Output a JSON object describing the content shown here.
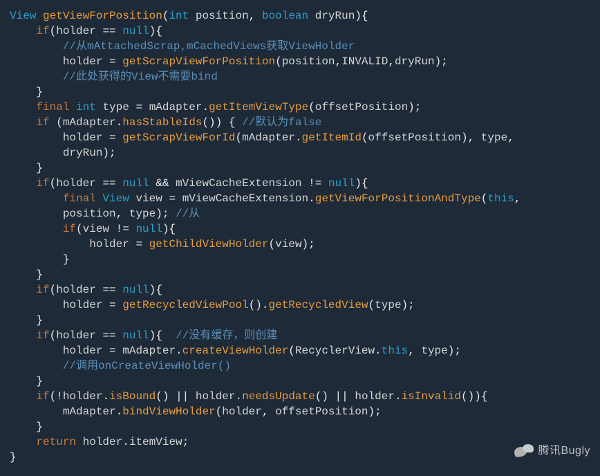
{
  "code": {
    "lines": [
      [
        [
          "t-type",
          "View"
        ],
        [
          "t-default",
          " "
        ],
        [
          "t-method",
          "getViewForPosition"
        ],
        [
          "t-default",
          "("
        ],
        [
          "t-type",
          "int"
        ],
        [
          "t-default",
          " "
        ],
        [
          "t-param",
          "position"
        ],
        [
          "t-default",
          ", "
        ],
        [
          "t-type",
          "boolean"
        ],
        [
          "t-default",
          " "
        ],
        [
          "t-param",
          "dryRun"
        ],
        [
          "t-default",
          ")"
        ],
        [
          "t-default",
          "{"
        ]
      ],
      [
        [
          "t-default",
          "    "
        ],
        [
          "t-keyword",
          "if"
        ],
        [
          "t-default",
          "("
        ],
        [
          "t-param",
          "holder"
        ],
        [
          "t-default",
          " "
        ],
        [
          "t-op",
          "=="
        ],
        [
          "t-default",
          " "
        ],
        [
          "t-type",
          "null"
        ],
        [
          "t-default",
          ")"
        ],
        [
          "t-default",
          "{"
        ]
      ],
      [
        [
          "t-default",
          "        "
        ],
        [
          "t-comment",
          "//从mAttachedScrap,mCachedViews获取ViewHolder"
        ]
      ],
      [
        [
          "t-default",
          "        "
        ],
        [
          "t-param",
          "holder"
        ],
        [
          "t-default",
          " "
        ],
        [
          "t-op",
          "="
        ],
        [
          "t-default",
          " "
        ],
        [
          "t-method",
          "getScrapViewForPosition"
        ],
        [
          "t-default",
          "("
        ],
        [
          "t-param",
          "position"
        ],
        [
          "t-default",
          ","
        ],
        [
          "t-param",
          "INVALID"
        ],
        [
          "t-default",
          ","
        ],
        [
          "t-param",
          "dryRun"
        ],
        [
          "t-default",
          ")"
        ],
        [
          "t-default",
          ";"
        ]
      ],
      [
        [
          "t-default",
          "        "
        ],
        [
          "t-comment",
          "//此处获得的View不需要bind"
        ]
      ],
      [
        [
          "t-default",
          "    "
        ],
        [
          "t-default",
          "}"
        ]
      ],
      [
        [
          "t-default",
          "    "
        ],
        [
          "t-keyword",
          "final"
        ],
        [
          "t-default",
          " "
        ],
        [
          "t-type",
          "int"
        ],
        [
          "t-default",
          " "
        ],
        [
          "t-param",
          "type"
        ],
        [
          "t-default",
          " "
        ],
        [
          "t-op",
          "="
        ],
        [
          "t-default",
          " "
        ],
        [
          "t-param",
          "mAdapter"
        ],
        [
          "t-default",
          "."
        ],
        [
          "t-method",
          "getItemViewType"
        ],
        [
          "t-default",
          "("
        ],
        [
          "t-param",
          "offsetPosition"
        ],
        [
          "t-default",
          ")"
        ],
        [
          "t-default",
          ";"
        ]
      ],
      [
        [
          "t-default",
          "    "
        ],
        [
          "t-keyword",
          "if"
        ],
        [
          "t-default",
          " ("
        ],
        [
          "t-param",
          "mAdapter"
        ],
        [
          "t-default",
          "."
        ],
        [
          "t-method",
          "hasStableIds"
        ],
        [
          "t-default",
          "()"
        ],
        [
          "t-default",
          ") "
        ],
        [
          "t-default",
          "{ "
        ],
        [
          "t-comment",
          "//默认为false"
        ]
      ],
      [
        [
          "t-default",
          "        "
        ],
        [
          "t-param",
          "holder"
        ],
        [
          "t-default",
          " "
        ],
        [
          "t-op",
          "="
        ],
        [
          "t-default",
          " "
        ],
        [
          "t-method",
          "getScrapViewForId"
        ],
        [
          "t-default",
          "("
        ],
        [
          "t-param",
          "mAdapter"
        ],
        [
          "t-default",
          "."
        ],
        [
          "t-method",
          "getItemId"
        ],
        [
          "t-default",
          "("
        ],
        [
          "t-param",
          "offsetPosition"
        ],
        [
          "t-default",
          ")"
        ],
        [
          "t-default",
          ", "
        ],
        [
          "t-param",
          "type"
        ],
        [
          "t-default",
          ", "
        ]
      ],
      [
        [
          "t-default",
          "        "
        ],
        [
          "t-param",
          "dryRun"
        ],
        [
          "t-default",
          ")"
        ],
        [
          "t-default",
          ";"
        ]
      ],
      [
        [
          "t-default",
          "    "
        ],
        [
          "t-default",
          "}"
        ]
      ],
      [
        [
          "t-default",
          "    "
        ],
        [
          "t-keyword",
          "if"
        ],
        [
          "t-default",
          "("
        ],
        [
          "t-param",
          "holder"
        ],
        [
          "t-default",
          " "
        ],
        [
          "t-op",
          "=="
        ],
        [
          "t-default",
          " "
        ],
        [
          "t-type",
          "null"
        ],
        [
          "t-default",
          " "
        ],
        [
          "t-op",
          "&&"
        ],
        [
          "t-default",
          " "
        ],
        [
          "t-param",
          "mViewCacheExtension"
        ],
        [
          "t-default",
          " "
        ],
        [
          "t-op",
          "!="
        ],
        [
          "t-default",
          " "
        ],
        [
          "t-type",
          "null"
        ],
        [
          "t-default",
          ")"
        ],
        [
          "t-default",
          "{"
        ]
      ],
      [
        [
          "t-default",
          "        "
        ],
        [
          "t-keyword",
          "final"
        ],
        [
          "t-default",
          " "
        ],
        [
          "t-type",
          "View"
        ],
        [
          "t-default",
          " "
        ],
        [
          "t-param",
          "view"
        ],
        [
          "t-default",
          " "
        ],
        [
          "t-op",
          "="
        ],
        [
          "t-default",
          " "
        ],
        [
          "t-param",
          "mViewCacheExtension"
        ],
        [
          "t-default",
          "."
        ],
        [
          "t-method",
          "getViewForPositionAndType"
        ],
        [
          "t-default",
          "("
        ],
        [
          "t-type",
          "this"
        ],
        [
          "t-default",
          ", "
        ]
      ],
      [
        [
          "t-default",
          "        "
        ],
        [
          "t-param",
          "position"
        ],
        [
          "t-default",
          ", "
        ],
        [
          "t-param",
          "type"
        ],
        [
          "t-default",
          ")"
        ],
        [
          "t-default",
          "; "
        ],
        [
          "t-comment",
          "//从"
        ]
      ],
      [
        [
          "t-default",
          "        "
        ],
        [
          "t-keyword",
          "if"
        ],
        [
          "t-default",
          "("
        ],
        [
          "t-param",
          "view"
        ],
        [
          "t-default",
          " "
        ],
        [
          "t-op",
          "!="
        ],
        [
          "t-default",
          " "
        ],
        [
          "t-type",
          "null"
        ],
        [
          "t-default",
          ")"
        ],
        [
          "t-default",
          "{"
        ]
      ],
      [
        [
          "t-default",
          "            "
        ],
        [
          "t-param",
          "holder"
        ],
        [
          "t-default",
          " "
        ],
        [
          "t-op",
          "="
        ],
        [
          "t-default",
          " "
        ],
        [
          "t-method",
          "getChildViewHolder"
        ],
        [
          "t-default",
          "("
        ],
        [
          "t-param",
          "view"
        ],
        [
          "t-default",
          ")"
        ],
        [
          "t-default",
          ";"
        ]
      ],
      [
        [
          "t-default",
          "        "
        ],
        [
          "t-default",
          "}"
        ]
      ],
      [
        [
          "t-default",
          "    "
        ],
        [
          "t-default",
          "}"
        ]
      ],
      [
        [
          "t-default",
          "    "
        ],
        [
          "t-keyword",
          "if"
        ],
        [
          "t-default",
          "("
        ],
        [
          "t-param",
          "holder"
        ],
        [
          "t-default",
          " "
        ],
        [
          "t-op",
          "=="
        ],
        [
          "t-default",
          " "
        ],
        [
          "t-type",
          "null"
        ],
        [
          "t-default",
          ")"
        ],
        [
          "t-default",
          "{"
        ]
      ],
      [
        [
          "t-default",
          "        "
        ],
        [
          "t-param",
          "holder"
        ],
        [
          "t-default",
          " "
        ],
        [
          "t-op",
          "="
        ],
        [
          "t-default",
          " "
        ],
        [
          "t-method",
          "getRecycledViewPool"
        ],
        [
          "t-default",
          "()"
        ],
        [
          "t-default",
          "."
        ],
        [
          "t-method",
          "getRecycledView"
        ],
        [
          "t-default",
          "("
        ],
        [
          "t-param",
          "type"
        ],
        [
          "t-default",
          ")"
        ],
        [
          "t-default",
          ";"
        ]
      ],
      [
        [
          "t-default",
          "    "
        ],
        [
          "t-default",
          "}"
        ]
      ],
      [
        [
          "t-default",
          "    "
        ],
        [
          "t-keyword",
          "if"
        ],
        [
          "t-default",
          "("
        ],
        [
          "t-param",
          "holder"
        ],
        [
          "t-default",
          " "
        ],
        [
          "t-op",
          "=="
        ],
        [
          "t-default",
          " "
        ],
        [
          "t-type",
          "null"
        ],
        [
          "t-default",
          ")"
        ],
        [
          "t-default",
          "{  "
        ],
        [
          "t-comment",
          "//没有缓存，则创建"
        ]
      ],
      [
        [
          "t-default",
          "        "
        ],
        [
          "t-param",
          "holder"
        ],
        [
          "t-default",
          " "
        ],
        [
          "t-op",
          "="
        ],
        [
          "t-default",
          " "
        ],
        [
          "t-param",
          "mAdapter"
        ],
        [
          "t-default",
          "."
        ],
        [
          "t-method",
          "createViewHolder"
        ],
        [
          "t-default",
          "("
        ],
        [
          "t-param",
          "RecyclerView"
        ],
        [
          "t-default",
          "."
        ],
        [
          "t-type",
          "this"
        ],
        [
          "t-default",
          ", "
        ],
        [
          "t-param",
          "type"
        ],
        [
          "t-default",
          ")"
        ],
        [
          "t-default",
          ";"
        ]
      ],
      [
        [
          "t-default",
          "        "
        ],
        [
          "t-comment",
          "//调用onCreateViewHolder()"
        ]
      ],
      [
        [
          "t-default",
          "    "
        ],
        [
          "t-default",
          "}"
        ]
      ],
      [
        [
          "t-default",
          "    "
        ],
        [
          "t-keyword",
          "if"
        ],
        [
          "t-default",
          "("
        ],
        [
          "t-op",
          "!"
        ],
        [
          "t-param",
          "holder"
        ],
        [
          "t-default",
          "."
        ],
        [
          "t-method",
          "isBound"
        ],
        [
          "t-default",
          "()"
        ],
        [
          "t-default",
          " "
        ],
        [
          "t-op",
          "||"
        ],
        [
          "t-default",
          " "
        ],
        [
          "t-param",
          "holder"
        ],
        [
          "t-default",
          "."
        ],
        [
          "t-method",
          "needsUpdate"
        ],
        [
          "t-default",
          "()"
        ],
        [
          "t-default",
          " "
        ],
        [
          "t-op",
          "||"
        ],
        [
          "t-default",
          " "
        ],
        [
          "t-param",
          "holder"
        ],
        [
          "t-default",
          "."
        ],
        [
          "t-method",
          "isInvalid"
        ],
        [
          "t-default",
          "()"
        ],
        [
          "t-default",
          ")"
        ],
        [
          "t-default",
          "{"
        ]
      ],
      [
        [
          "t-default",
          "        "
        ],
        [
          "t-param",
          "mAdapter"
        ],
        [
          "t-default",
          "."
        ],
        [
          "t-method",
          "bindViewHolder"
        ],
        [
          "t-default",
          "("
        ],
        [
          "t-param",
          "holder"
        ],
        [
          "t-default",
          ", "
        ],
        [
          "t-param",
          "offsetPosition"
        ],
        [
          "t-default",
          ")"
        ],
        [
          "t-default",
          ";"
        ]
      ],
      [
        [
          "t-default",
          "    "
        ],
        [
          "t-default",
          "}"
        ]
      ],
      [
        [
          "t-default",
          "    "
        ],
        [
          "t-keyword",
          "return"
        ],
        [
          "t-default",
          " "
        ],
        [
          "t-param",
          "holder"
        ],
        [
          "t-default",
          "."
        ],
        [
          "t-param",
          "itemView"
        ],
        [
          "t-default",
          ";"
        ]
      ],
      [
        [
          "t-default",
          "}"
        ]
      ]
    ]
  },
  "watermark": {
    "label": "腾讯Bugly"
  }
}
